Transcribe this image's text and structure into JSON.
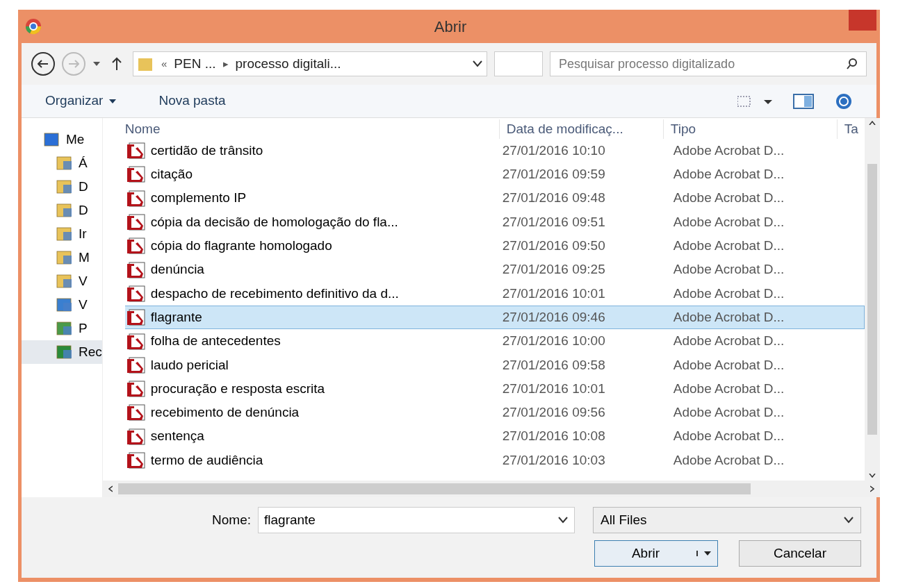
{
  "window": {
    "title": "Abrir"
  },
  "address": {
    "path": [
      "«",
      "PEN ...",
      "▸",
      "processo digitali..."
    ]
  },
  "search": {
    "placeholder": "Pesquisar processo digitalizado"
  },
  "toolbar": {
    "items": [
      "Organizar",
      "Nova pasta"
    ]
  },
  "sidebar": {
    "items": [
      {
        "label": "Me",
        "kind": "computer",
        "selected": false
      },
      {
        "label": "Á",
        "kind": "desktop",
        "selected": false
      },
      {
        "label": "D",
        "kind": "documents",
        "selected": false
      },
      {
        "label": "D",
        "kind": "downloads",
        "selected": false
      },
      {
        "label": "Ir",
        "kind": "images",
        "selected": false
      },
      {
        "label": "M",
        "kind": "music",
        "selected": false
      },
      {
        "label": "V",
        "kind": "videos",
        "selected": false
      },
      {
        "label": "V",
        "kind": "drive",
        "selected": false
      },
      {
        "label": "P",
        "kind": "network-drive",
        "selected": false
      },
      {
        "label": "Rec",
        "kind": "network",
        "selected": true
      }
    ]
  },
  "table": {
    "columns": [
      "Nome",
      "Data de modificaç...",
      "Tipo",
      "Ta"
    ],
    "rows": [
      {
        "name": "certidão de trânsito",
        "date": "27/01/2016 10:10",
        "type": "Adobe Acrobat D...",
        "selected": false
      },
      {
        "name": "citação",
        "date": "27/01/2016 09:59",
        "type": "Adobe Acrobat D...",
        "selected": false
      },
      {
        "name": "complemento IP",
        "date": "27/01/2016 09:48",
        "type": "Adobe Acrobat D...",
        "selected": false
      },
      {
        "name": "cópia da decisão de homologação do fla...",
        "date": "27/01/2016 09:51",
        "type": "Adobe Acrobat D...",
        "selected": false
      },
      {
        "name": "cópia do flagrante homologado",
        "date": "27/01/2016 09:50",
        "type": "Adobe Acrobat D...",
        "selected": false
      },
      {
        "name": "denúncia",
        "date": "27/01/2016 09:25",
        "type": "Adobe Acrobat D...",
        "selected": false
      },
      {
        "name": "despacho de recebimento definitivo da d...",
        "date": "27/01/2016 10:01",
        "type": "Adobe Acrobat D...",
        "selected": false
      },
      {
        "name": "flagrante",
        "date": "27/01/2016 09:46",
        "type": "Adobe Acrobat D...",
        "selected": true
      },
      {
        "name": "folha de antecedentes",
        "date": "27/01/2016 10:00",
        "type": "Adobe Acrobat D...",
        "selected": false
      },
      {
        "name": "laudo pericial",
        "date": "27/01/2016 09:58",
        "type": "Adobe Acrobat D...",
        "selected": false
      },
      {
        "name": "procuração e resposta escrita",
        "date": "27/01/2016 10:01",
        "type": "Adobe Acrobat D...",
        "selected": false
      },
      {
        "name": "recebimento de denúncia",
        "date": "27/01/2016 09:56",
        "type": "Adobe Acrobat D...",
        "selected": false
      },
      {
        "name": "sentença",
        "date": "27/01/2016 10:08",
        "type": "Adobe Acrobat D...",
        "selected": false
      },
      {
        "name": "termo de audiência",
        "date": "27/01/2016 10:03",
        "type": "Adobe Acrobat D...",
        "selected": false
      }
    ]
  },
  "footer": {
    "name_label": "Nome:",
    "name_value": "flagrante",
    "filter": "All Files",
    "buttons": [
      "Abrir",
      "Cancelar"
    ]
  }
}
